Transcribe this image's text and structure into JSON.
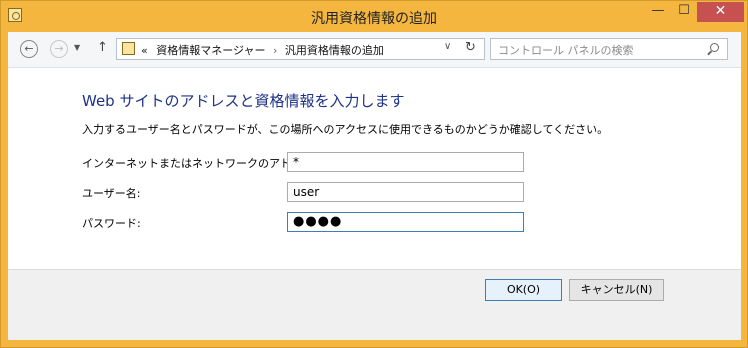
{
  "window": {
    "title": "汎用資格情報の追加",
    "minimize": "—",
    "maximize": "☐",
    "close": "✕"
  },
  "nav": {
    "back": "←",
    "forward": "→",
    "dropdown": "▼",
    "up": "↑",
    "address": {
      "prefix": "«",
      "crumbs": [
        "資格情報マネージャー",
        "汎用資格情報の追加"
      ],
      "separator": "›",
      "chevron": "∨"
    },
    "refresh": "↻",
    "search_placeholder": "コントロール パネルの検索"
  },
  "form": {
    "heading": "Web サイトのアドレスと資格情報を入力します",
    "description": "入力するユーザー名とパスワードが、この場所へのアクセスに使用できるものかどうか確認してください。",
    "address_label": "インターネットまたはネットワークのアドレス:",
    "address_value": "*",
    "username_label": "ユーザー名:",
    "username_value": "user",
    "password_label": "パスワード:",
    "password_display": "●●●●"
  },
  "buttons": {
    "ok": "OK(O)",
    "cancel": "キャンセル(N)"
  },
  "colors": {
    "frame": "#f4b63f",
    "close_button": "#c75050",
    "heading": "#1e3287"
  }
}
